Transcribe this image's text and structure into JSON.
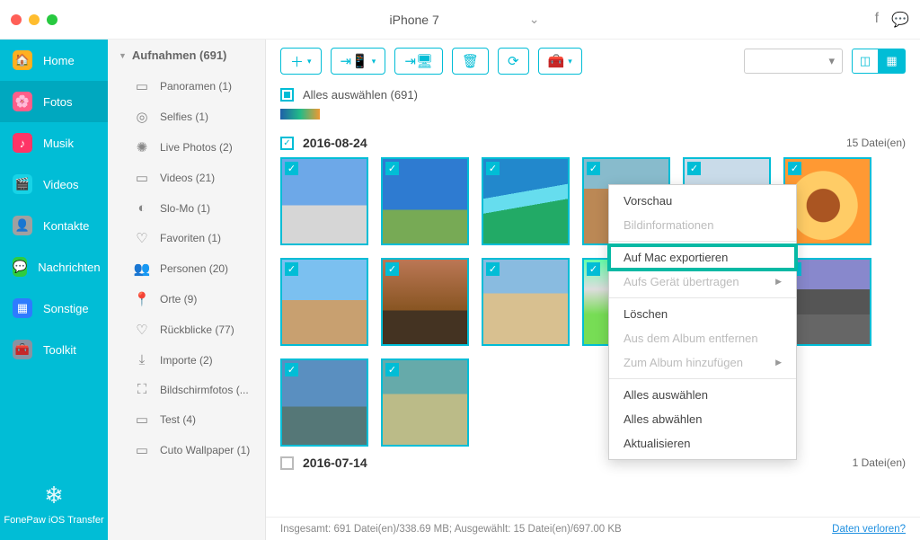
{
  "title": {
    "device": "iPhone 7"
  },
  "sidebar": {
    "items": [
      {
        "label": "Home"
      },
      {
        "label": "Fotos"
      },
      {
        "label": "Musik"
      },
      {
        "label": "Videos"
      },
      {
        "label": "Kontakte"
      },
      {
        "label": "Nachrichten"
      },
      {
        "label": "Sonstige"
      },
      {
        "label": "Toolkit"
      }
    ],
    "brand": "FonePaw iOS Transfer"
  },
  "albums": {
    "header": "Aufnahmen (691)",
    "items": [
      {
        "label": "Panoramen (1)"
      },
      {
        "label": "Selfies (1)"
      },
      {
        "label": "Live Photos (2)"
      },
      {
        "label": "Videos (21)"
      },
      {
        "label": "Slo-Mo (1)"
      },
      {
        "label": "Favoriten (1)"
      },
      {
        "label": "Personen (20)"
      },
      {
        "label": "Orte (9)"
      },
      {
        "label": "Rückblicke (77)"
      },
      {
        "label": "Importe (2)"
      },
      {
        "label": "Bildschirmfotos (..."
      },
      {
        "label": "Test (4)"
      },
      {
        "label": "Cuto Wallpaper (1)"
      }
    ]
  },
  "selectall": "Alles auswählen (691)",
  "groups": [
    {
      "date": "2016-08-24",
      "count": "15 Datei(en)",
      "checked": true,
      "thumbs": 14
    },
    {
      "date": "2016-07-14",
      "count": "1 Datei(en)",
      "checked": false,
      "thumbs": 0
    }
  ],
  "context": {
    "preview": "Vorschau",
    "info": "Bildinformationen",
    "export_mac": "Auf Mac exportieren",
    "to_device": "Aufs Gerät übertragen",
    "delete": "Löschen",
    "remove_album": "Aus dem Album entfernen",
    "add_album": "Zum Album hinzufügen",
    "select_all": "Alles auswählen",
    "deselect_all": "Alles abwählen",
    "refresh": "Aktualisieren"
  },
  "status": {
    "text": "Insgesamt: 691 Datei(en)/338.69 MB; Ausgewählt: 15 Datei(en)/697.00 KB",
    "link": "Daten verloren?"
  }
}
